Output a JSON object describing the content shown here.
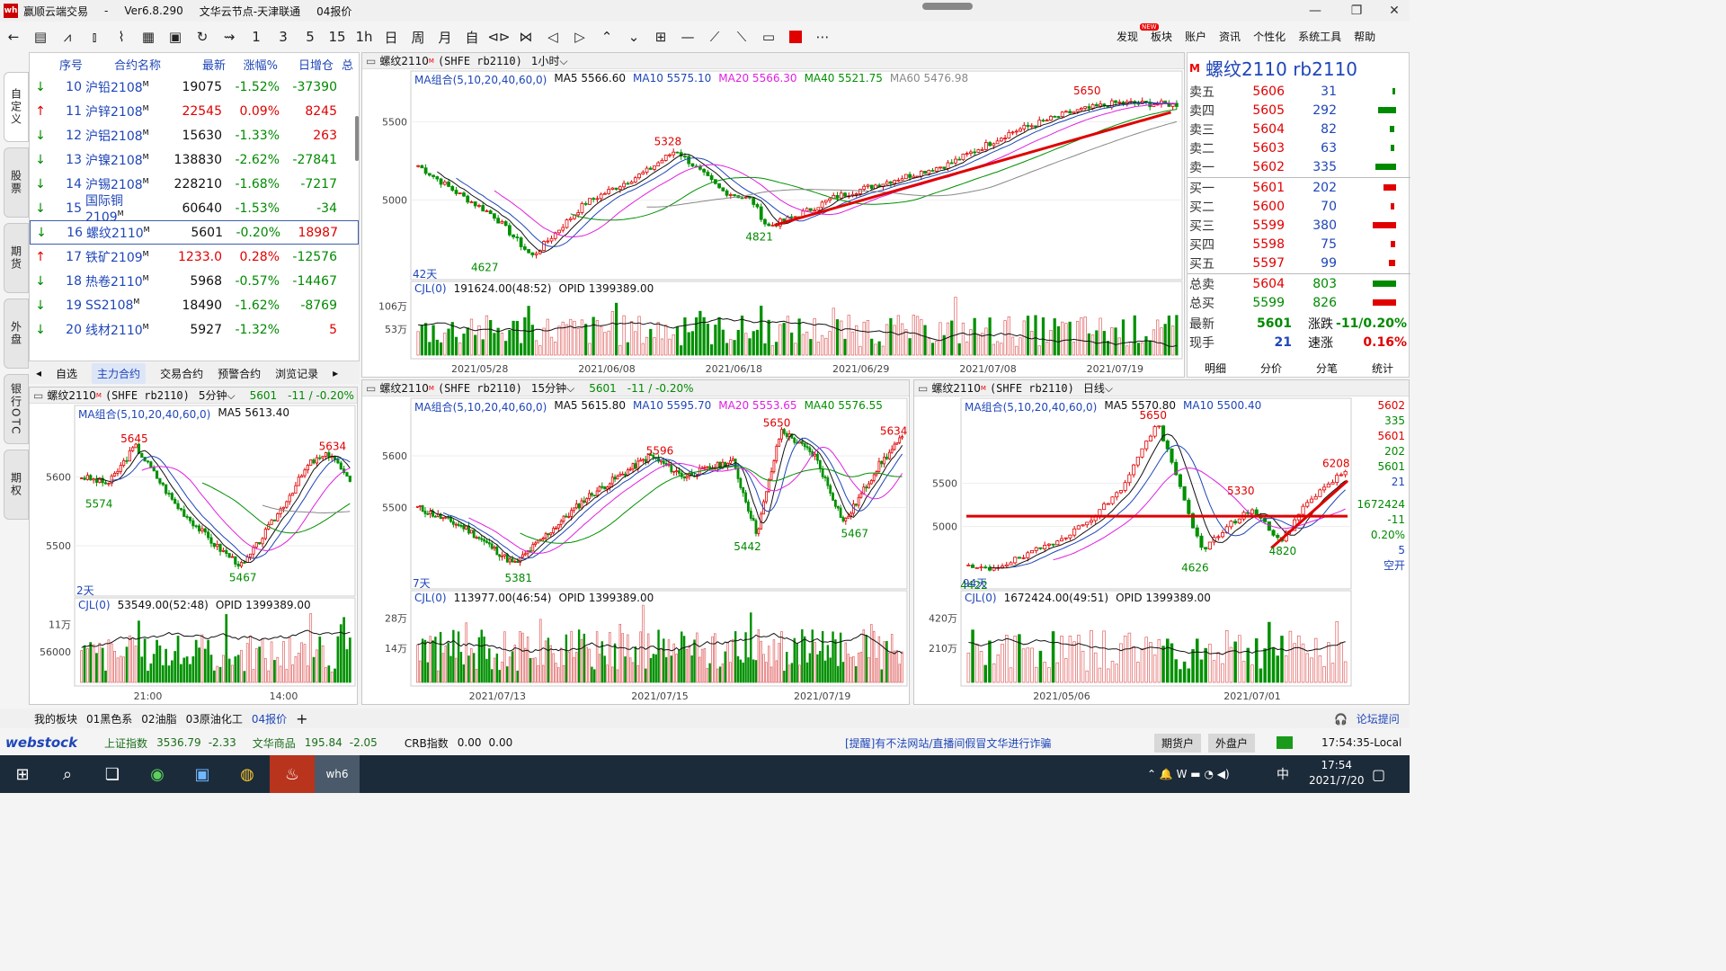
{
  "title": {
    "app": "赢顺云端交易",
    "version": "Ver6.8.290",
    "node": "文华云节点-天津联通",
    "page": "04报价"
  },
  "menu": [
    "发现",
    "板块",
    "账户",
    "资讯",
    "个性化",
    "系统工具",
    "帮助"
  ],
  "menu_badge": "NEW",
  "toolbar_icons": [
    "back-arrow-icon",
    "quote-list-icon",
    "line-chart-icon",
    "bar-chart-icon",
    "tick-chart-icon",
    "kline-icon",
    "save-icon",
    "refresh-icon",
    "draw-icon",
    "period-1-icon",
    "period-3-icon",
    "period-5-icon",
    "period-15-icon",
    "period-1h-icon",
    "day-icon",
    "week-icon",
    "month-icon",
    "custom-icon",
    "zoom-in-icon",
    "zoom-out-icon",
    "prev-icon",
    "next-icon",
    "up-icon",
    "down-icon",
    "layout-icon",
    "hline-icon",
    "tline-icon",
    "ray-icon",
    "rect-icon",
    "color-icon",
    "more-icon"
  ],
  "toolbar_labels": [
    "1",
    "3",
    "5",
    "15",
    "1h",
    "日",
    "周",
    "月",
    "自"
  ],
  "left_tabs": [
    "自定义",
    "股票",
    "期货",
    "外盘",
    "银行OTC",
    "期权"
  ],
  "quote": {
    "headers": [
      "序号",
      "合约名称",
      "最新",
      "涨幅%",
      "日增仓",
      "总"
    ],
    "rows": [
      {
        "dir": "down",
        "no": "10",
        "name": "沪铅2108",
        "last": "19075",
        "chg": "-1.52%",
        "oi": "-37390"
      },
      {
        "dir": "up",
        "no": "11",
        "name": "沪锌2108",
        "last": "22545",
        "chg": "0.09%",
        "oi": "8245"
      },
      {
        "dir": "down",
        "no": "12",
        "name": "沪铝2108",
        "last": "15630",
        "chg": "-1.33%",
        "oi": "263"
      },
      {
        "dir": "down",
        "no": "13",
        "name": "沪镍2108",
        "last": "138830",
        "chg": "-2.62%",
        "oi": "-27841"
      },
      {
        "dir": "down",
        "no": "14",
        "name": "沪锡2108",
        "last": "228210",
        "chg": "-1.68%",
        "oi": "-7217"
      },
      {
        "dir": "down",
        "no": "15",
        "name": "国际铜2109",
        "last": "60640",
        "chg": "-1.53%",
        "oi": "-34"
      },
      {
        "dir": "down",
        "no": "16",
        "name": "螺纹2110",
        "last": "5601",
        "chg": "-0.20%",
        "oi": "18987"
      },
      {
        "dir": "up",
        "no": "17",
        "name": "铁矿2109",
        "last": "1233.0",
        "chg": "0.28%",
        "oi": "-12576"
      },
      {
        "dir": "down",
        "no": "18",
        "name": "热卷2110",
        "last": "5968",
        "chg": "-0.57%",
        "oi": "-14467"
      },
      {
        "dir": "down",
        "no": "19",
        "name": "SS2108",
        "last": "18490",
        "chg": "-1.62%",
        "oi": "-8769"
      },
      {
        "dir": "down",
        "no": "20",
        "name": "线材2110",
        "last": "5927",
        "chg": "-1.32%",
        "oi": "5"
      }
    ],
    "marker": "M",
    "tabs": [
      "自选",
      "主力合约",
      "交易合约",
      "预警合约",
      "浏览记录"
    ],
    "active_tab": "主力合约"
  },
  "charts": [
    {
      "id": "main",
      "header": "螺纹2110",
      "exch": "(SHFE rb2110)",
      "period": "1小时",
      "ma": [
        "MA组合(5,10,20,40,60,0)",
        "MA5 5566.60",
        "MA10 5575.10",
        "MA20 5566.30",
        "MA40 5521.75",
        "MA60 5476.98"
      ],
      "yticks": [
        "5500",
        "5000"
      ],
      "labels": [
        "5650",
        "5328",
        "4821",
        "4627"
      ],
      "days": "42天",
      "vol": "CJL(0)",
      "vol_val": "191624.00(48:52)",
      "opid": "OPID 1399389.00",
      "vticks": [
        "106万",
        "53万"
      ],
      "xticks": [
        "2021/05/28",
        "2021/06/08",
        "2021/06/18",
        "2021/06/29",
        "2021/07/08",
        "2021/07/19"
      ]
    },
    {
      "id": "m5",
      "header": "螺纹2110",
      "exch": "(SHFE rb2110)",
      "period": "5分钟",
      "last": "5601",
      "chg": "-11 / -0.20%",
      "ma": [
        "MA组合(5,10,20,40,60,0)",
        "MA5 5613.40"
      ],
      "yticks": [
        "5600",
        "5500"
      ],
      "labels": [
        "5645",
        "5634",
        "5574",
        "5467"
      ],
      "days": "2天",
      "vol": "CJL(0)",
      "vol_val": "53549.00(52:48)",
      "opid": "OPID 1399389.00",
      "vticks": [
        "11万",
        "56000"
      ],
      "xticks": [
        "21:00",
        "14:00"
      ]
    },
    {
      "id": "m15",
      "header": "螺纹2110",
      "exch": "(SHFE rb2110)",
      "period": "15分钟",
      "last": "5601",
      "chg": "-11 / -0.20%",
      "ma": [
        "MA组合(5,10,20,40,60,0)",
        "MA5 5615.80",
        "MA10 5595.70",
        "MA20 5553.65",
        "MA40 5576.55"
      ],
      "yticks": [
        "5600",
        "5500"
      ],
      "labels": [
        "5650",
        "5634",
        "5596",
        "5442",
        "5467",
        "5381"
      ],
      "days": "7天",
      "vol": "CJL(0)",
      "vol_val": "113977.00(46:54)",
      "opid": "OPID 1399389.00",
      "vticks": [
        "28万",
        "14万"
      ],
      "xticks": [
        "2021/07/13",
        "2021/07/15",
        "2021/07/19"
      ]
    },
    {
      "id": "day",
      "header": "螺纹2110",
      "exch": "(SHFE rb2110)",
      "period": "日线",
      "ma": [
        "MA组合(5,10,20,40,60,0)",
        "MA5 5570.80",
        "MA10 5500.40"
      ],
      "yticks": [
        "5500",
        "5000"
      ],
      "labels": [
        "6208",
        "5330",
        "5650",
        "4626",
        "4820",
        "4422"
      ],
      "days": "94天",
      "vol": "CJL(0)",
      "vol_val": "1672424.00(49:51)",
      "opid": "OPID 1399389.00",
      "vticks": [
        "420万",
        "210万"
      ],
      "xticks": [
        "2021/05/06",
        "2021/07/01"
      ],
      "side": [
        "5602",
        "335",
        "5601",
        "202",
        "5601",
        "21",
        "1672424",
        "-11",
        "0.20%",
        "5",
        "空开"
      ]
    }
  ],
  "orderbook": {
    "title": "螺纹2110  rb2110",
    "badge": "M",
    "asks": [
      {
        "l": "卖五",
        "p": "5606",
        "v": "31",
        "bar": 0.05
      },
      {
        "l": "卖四",
        "p": "5605",
        "v": "292",
        "bar": 0.45
      },
      {
        "l": "卖三",
        "p": "5604",
        "v": "82",
        "bar": 0.12
      },
      {
        "l": "卖二",
        "p": "5603",
        "v": "63",
        "bar": 0.1
      },
      {
        "l": "卖一",
        "p": "5602",
        "v": "335",
        "bar": 0.52
      }
    ],
    "bids": [
      {
        "l": "买一",
        "p": "5601",
        "v": "202",
        "bar": 0.31
      },
      {
        "l": "买二",
        "p": "5600",
        "v": "70",
        "bar": 0.1
      },
      {
        "l": "买三",
        "p": "5599",
        "v": "380",
        "bar": 0.6
      },
      {
        "l": "买四",
        "p": "5598",
        "v": "75",
        "bar": 0.11
      },
      {
        "l": "买五",
        "p": "5597",
        "v": "99",
        "bar": 0.15
      }
    ],
    "total_sell": {
      "l": "总卖",
      "p": "5604",
      "v": "803",
      "bar": 0.6
    },
    "total_buy": {
      "l": "总买",
      "p": "5599",
      "v": "826",
      "bar": 0.6
    },
    "last_l": "最新",
    "last": "5601",
    "chg_l": "涨跌",
    "chg": "-11/0.20%",
    "hand_l": "现手",
    "hand": "21",
    "speed_l": "速涨",
    "speed": "0.16%",
    "tabs": [
      "明细",
      "分价",
      "分笔",
      "统计"
    ]
  },
  "bottom": {
    "items": [
      "我的板块",
      "01黑色系",
      "02油脂",
      "03原油化工",
      "04报价"
    ],
    "active": "04报价",
    "plus": "+",
    "forum": "论坛提问"
  },
  "status": {
    "brand": "webstock",
    "sh": "上证指数",
    "sh_v": "3536.79",
    "sh_c": "-2.33",
    "wh": "文华商品",
    "wh_v": "195.84",
    "wh_c": "-2.05",
    "crb": "CRB指数",
    "crb_v": "0.00",
    "crb_c": "0.00",
    "notice": "[提醒]有不法网站/直播间假冒文华进行诈骗",
    "b1": "期货户",
    "b2": "外盘户",
    "time": "17:54:35-Local"
  },
  "taskbar": {
    "time": "17:54",
    "date": "2021/7/20",
    "ime": "中"
  }
}
